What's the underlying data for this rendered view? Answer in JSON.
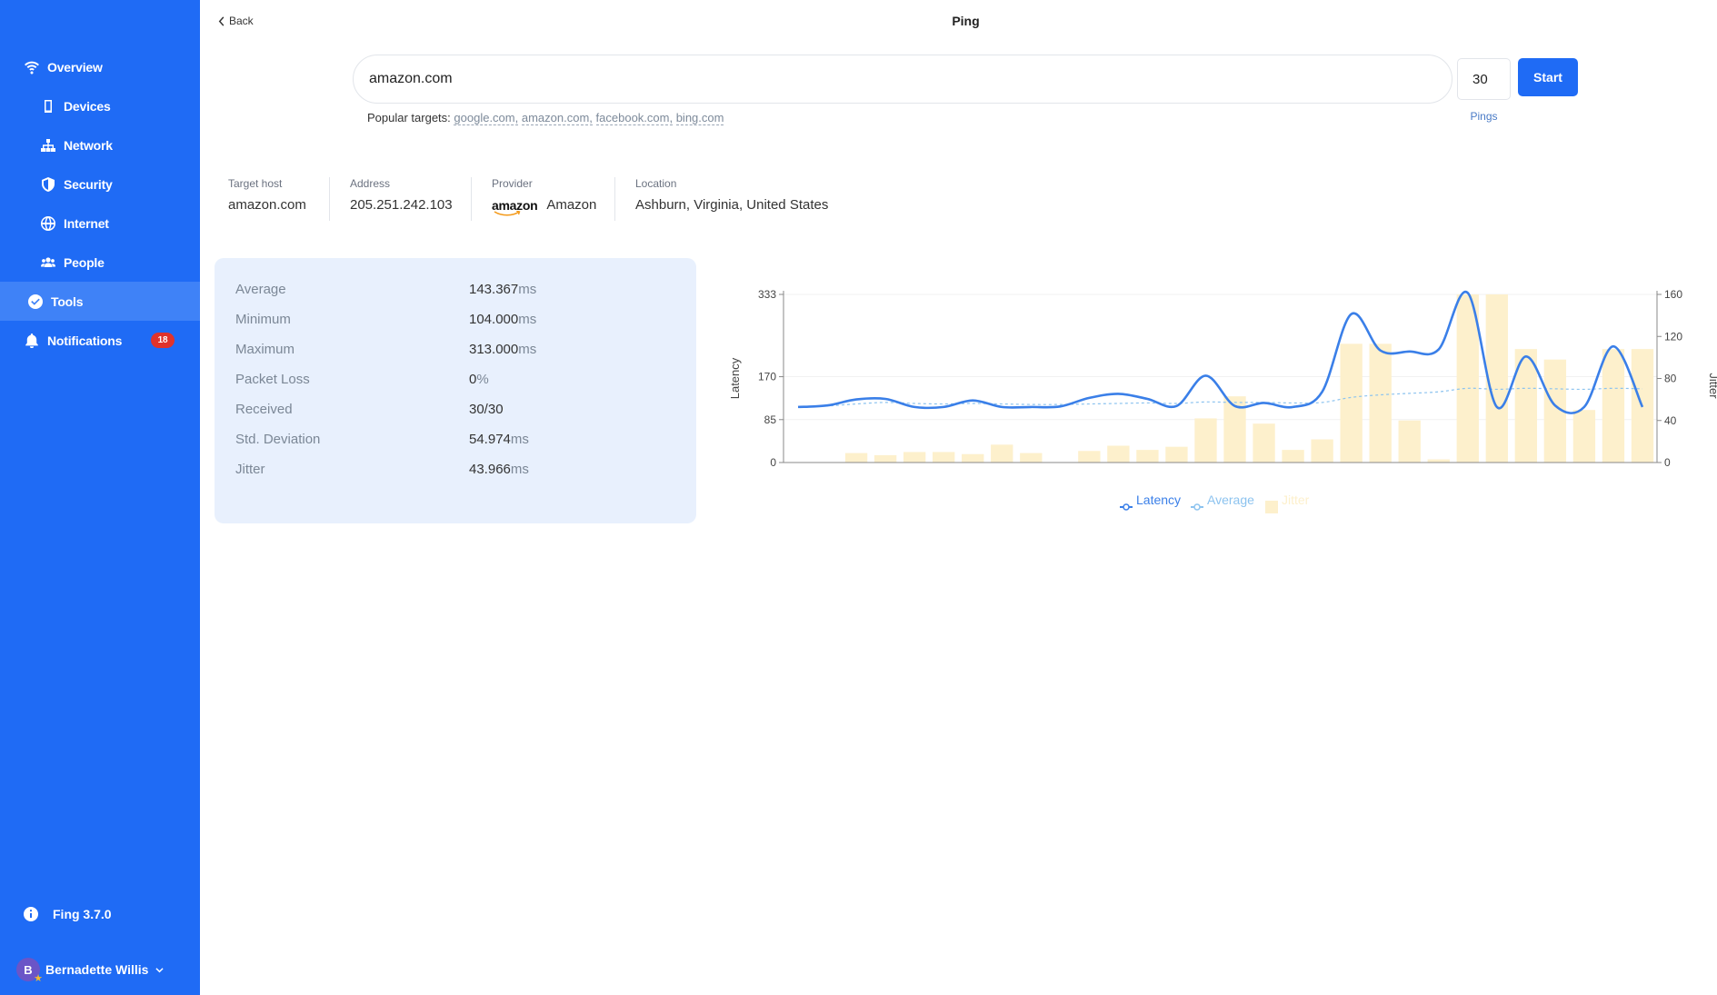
{
  "sidebar": {
    "items": [
      {
        "label": "Overview",
        "icon": "wifi-icon"
      },
      {
        "label": "Devices",
        "icon": "phone-icon"
      },
      {
        "label": "Network",
        "icon": "network-icon"
      },
      {
        "label": "Security",
        "icon": "shield-icon"
      },
      {
        "label": "Internet",
        "icon": "globe-icon"
      },
      {
        "label": "People",
        "icon": "people-icon"
      },
      {
        "label": "Tools",
        "icon": "check-circle-icon"
      },
      {
        "label": "Notifications",
        "icon": "bell-icon",
        "badge": "18"
      }
    ],
    "active": "Tools",
    "version": "Fing 3.7.0",
    "user": {
      "initial": "B",
      "name": "Bernadette Willis"
    }
  },
  "header": {
    "back": "Back",
    "title": "Ping"
  },
  "search": {
    "value": "amazon.com",
    "pings": "30",
    "pings_label": "Pings",
    "start": "Start"
  },
  "popular": {
    "label": "Popular targets:",
    "targets": [
      "google.com,",
      "amazon.com,",
      "facebook.com,",
      "bing.com"
    ]
  },
  "info": {
    "target_host": {
      "label": "Target host",
      "value": "amazon.com"
    },
    "address": {
      "label": "Address",
      "value": "205.251.242.103"
    },
    "provider": {
      "label": "Provider",
      "logo": "amazon",
      "value": "Amazon"
    },
    "location": {
      "label": "Location",
      "value": "Ashburn, Virginia, United States"
    }
  },
  "stats": [
    {
      "label": "Average",
      "value": "143.367",
      "unit": "ms"
    },
    {
      "label": "Minimum",
      "value": "104.000",
      "unit": "ms"
    },
    {
      "label": "Maximum",
      "value": "313.000",
      "unit": "ms"
    },
    {
      "label": "Packet Loss",
      "value": "0",
      "unit": "%"
    },
    {
      "label": "Received",
      "value": "30/30",
      "unit": ""
    },
    {
      "label": "Std. Deviation",
      "value": "54.974",
      "unit": "ms"
    },
    {
      "label": "Jitter",
      "value": "43.966",
      "unit": "ms"
    }
  ],
  "colors": {
    "accent": "#1f6bf5",
    "latency": "#3a7fe8",
    "average": "#8cc3ef",
    "jitter": "#fdf0cc"
  },
  "chart_data": {
    "type": "line",
    "x": [
      1,
      2,
      3,
      4,
      5,
      6,
      7,
      8,
      9,
      10,
      11,
      12,
      13,
      14,
      15,
      16,
      17,
      18,
      19,
      20,
      21,
      22,
      23,
      24,
      25,
      26,
      27,
      28,
      29,
      30
    ],
    "ylabel": "Latency",
    "y2label": "Jitter",
    "ylim": [
      0,
      333
    ],
    "y2lim": [
      0,
      160
    ],
    "yticks": [
      0,
      85,
      170,
      333
    ],
    "y2ticks": [
      0,
      40,
      80,
      120,
      160
    ],
    "grid": true,
    "legend_position": "bottom",
    "series": [
      {
        "name": "Latency",
        "type": "line",
        "axis": "left",
        "values": [
          110,
          113,
          125,
          126,
          110,
          110,
          123,
          110,
          110,
          111,
          128,
          136,
          126,
          112,
          172,
          112,
          118,
          110,
          140,
          294,
          222,
          220,
          224,
          336,
          110,
          210,
          113,
          110,
          230,
          110
        ]
      },
      {
        "name": "Average",
        "type": "line",
        "axis": "left",
        "values": [
          110,
          112,
          116,
          119,
          117,
          116,
          117,
          116,
          115,
          115,
          116,
          117,
          118,
          117,
          120,
          119,
          119,
          118,
          119,
          129,
          134,
          137,
          140,
          147,
          145,
          147,
          146,
          145,
          147,
          146
        ]
      },
      {
        "name": "Jitter",
        "type": "bar",
        "axis": "right",
        "values": [
          0,
          0,
          9,
          7,
          10,
          10,
          8,
          17,
          9,
          0,
          11,
          16,
          12,
          15,
          42,
          63,
          37,
          12,
          22,
          113,
          113,
          40,
          3,
          160,
          160,
          108,
          98,
          50,
          108,
          108
        ]
      }
    ]
  }
}
